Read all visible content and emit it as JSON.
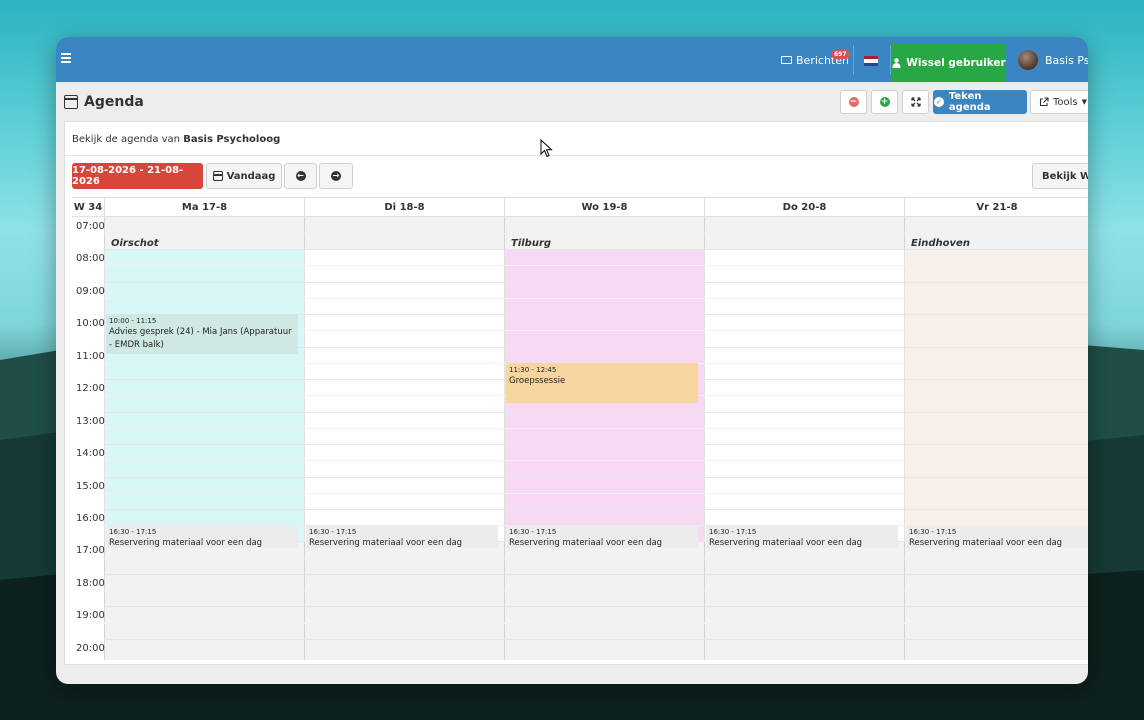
{
  "topbar": {
    "messages_label": "Berichten",
    "messages_count": "697",
    "switch_user_label": "Wissel gebruiker",
    "user_name": "Basis Psycholoog"
  },
  "page": {
    "title": "Agenda",
    "sign_button": "Teken agenda",
    "tools_button": "Tools",
    "subtitle_prefix": "Bekijk de agenda van",
    "subtitle_name": "Basis Psycholoog"
  },
  "nav": {
    "date_range": "17-08-2026 - 21-08-2026",
    "today_label": "Vandaag",
    "view_week_label": "Bekijk Week"
  },
  "calendar": {
    "week_label": "W 34",
    "days": [
      "Ma 17-8",
      "Di 18-8",
      "Wo 19-8",
      "Do 20-8",
      "Vr 21-8"
    ],
    "times": [
      "07:00",
      "08:00",
      "09:00",
      "10:00",
      "11:00",
      "12:00",
      "13:00",
      "14:00",
      "15:00",
      "16:00",
      "17:00",
      "18:00",
      "19:00",
      "20:00"
    ],
    "locations": {
      "monday": "Oirschot",
      "wednesday": "Tilburg",
      "friday": "Eindhoven"
    },
    "events": {
      "advies": {
        "time": "10:00 - 11:15",
        "title": "Advies gesprek (24) - Mia Jans (Apparatuur - EMDR balk)"
      },
      "groep": {
        "time": "11:30 - 12:45",
        "title": "Groepssessie"
      },
      "reservering_time": "16:30 - 17:15",
      "reservering_title": "Reservering materiaal voor een dag"
    }
  },
  "colors": {
    "topbar": "#3a86c3",
    "switch_user": "#27a844",
    "date_range": "#d9453b",
    "oirschot": "#d8f8f8",
    "tilburg": "#f8d9f4",
    "eindhoven": "#f7efea",
    "event_advies": "#cfe8e4",
    "event_groep": "#f6d59e"
  }
}
